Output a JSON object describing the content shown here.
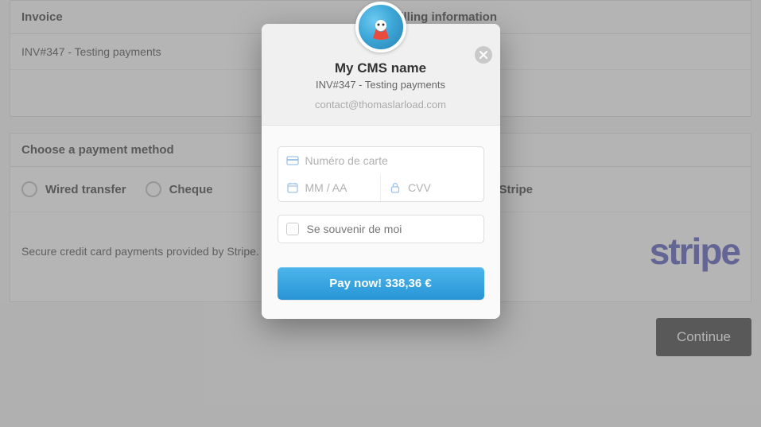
{
  "background": {
    "invoice_header": "Invoice",
    "billing_header": "Billing information",
    "invoice_line": "INV#347 - Testing payments",
    "choose_title": "Choose a payment method",
    "methods": {
      "wired": "Wired transfer",
      "cheque": "Cheque",
      "stripe": "Stripe"
    },
    "stripe_info": "Secure credit card payments provided by Stripe.",
    "stripe_logo": "stripe",
    "continue": "Continue"
  },
  "modal": {
    "title": "My CMS name",
    "subtitle": "INV#347 - Testing payments",
    "email": "contact@thomaslarload.com",
    "card_placeholder": "Numéro de carte",
    "expiry_placeholder": "MM / AA",
    "cvv_placeholder": "CVV",
    "remember_label": "Se souvenir de moi",
    "pay_button": "Pay now! 338,36 €"
  },
  "colors": {
    "pay_button_top": "#4db5ec",
    "pay_button_bottom": "#2795d5",
    "stripe_logo": "#4a4fb7",
    "continue_btn": "#333333"
  }
}
